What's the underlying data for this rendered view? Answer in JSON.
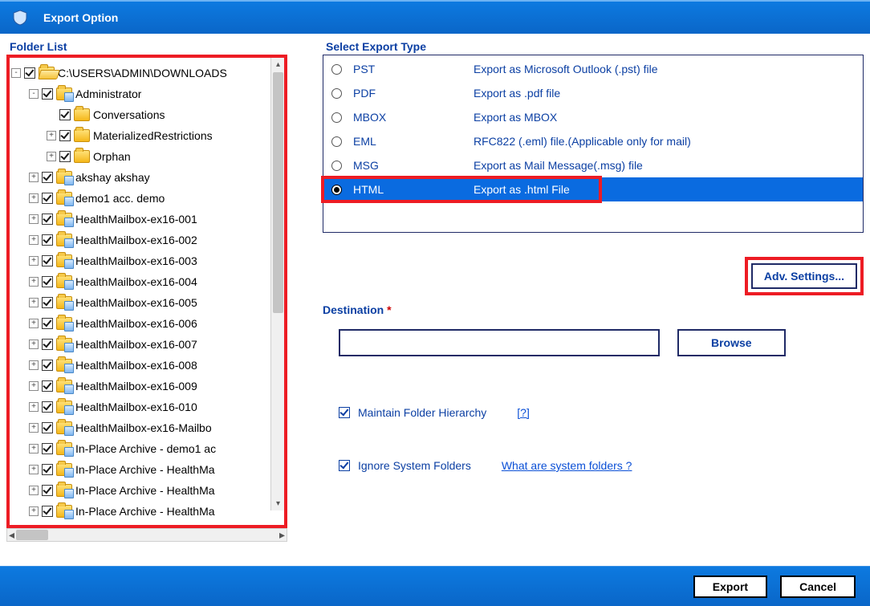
{
  "window": {
    "title": "Export Option"
  },
  "left": {
    "label": "Folder List",
    "tree": [
      {
        "depth": 0,
        "expander": "-",
        "icon": "open",
        "label": "C:\\USERS\\ADMIN\\DOWNLOADS"
      },
      {
        "depth": 1,
        "expander": "-",
        "icon": "db",
        "label": "Administrator"
      },
      {
        "depth": 2,
        "expander": "",
        "icon": "closed",
        "label": "Conversations"
      },
      {
        "depth": 2,
        "expander": "+",
        "icon": "closed",
        "label": "MaterializedRestrictions"
      },
      {
        "depth": 2,
        "expander": "+",
        "icon": "closed",
        "label": "Orphan"
      },
      {
        "depth": 1,
        "expander": "+",
        "icon": "db",
        "label": "akshay akshay"
      },
      {
        "depth": 1,
        "expander": "+",
        "icon": "db",
        "label": "demo1 acc. demo"
      },
      {
        "depth": 1,
        "expander": "+",
        "icon": "db",
        "label": "HealthMailbox-ex16-001"
      },
      {
        "depth": 1,
        "expander": "+",
        "icon": "db",
        "label": "HealthMailbox-ex16-002"
      },
      {
        "depth": 1,
        "expander": "+",
        "icon": "db",
        "label": "HealthMailbox-ex16-003"
      },
      {
        "depth": 1,
        "expander": "+",
        "icon": "db",
        "label": "HealthMailbox-ex16-004"
      },
      {
        "depth": 1,
        "expander": "+",
        "icon": "db",
        "label": "HealthMailbox-ex16-005"
      },
      {
        "depth": 1,
        "expander": "+",
        "icon": "db",
        "label": "HealthMailbox-ex16-006"
      },
      {
        "depth": 1,
        "expander": "+",
        "icon": "db",
        "label": "HealthMailbox-ex16-007"
      },
      {
        "depth": 1,
        "expander": "+",
        "icon": "db",
        "label": "HealthMailbox-ex16-008"
      },
      {
        "depth": 1,
        "expander": "+",
        "icon": "db",
        "label": "HealthMailbox-ex16-009"
      },
      {
        "depth": 1,
        "expander": "+",
        "icon": "db",
        "label": "HealthMailbox-ex16-010"
      },
      {
        "depth": 1,
        "expander": "+",
        "icon": "db",
        "label": "HealthMailbox-ex16-Mailbo"
      },
      {
        "depth": 1,
        "expander": "+",
        "icon": "db",
        "label": "In-Place Archive - demo1 ac"
      },
      {
        "depth": 1,
        "expander": "+",
        "icon": "db",
        "label": "In-Place Archive - HealthMa"
      },
      {
        "depth": 1,
        "expander": "+",
        "icon": "db",
        "label": "In-Place Archive - HealthMa"
      },
      {
        "depth": 1,
        "expander": "+",
        "icon": "db",
        "label": "In-Place Archive - HealthMa"
      }
    ]
  },
  "right": {
    "label": "Select Export Type",
    "formats": [
      {
        "fmt": "PST",
        "desc": "Export as Microsoft Outlook (.pst) file",
        "selected": false
      },
      {
        "fmt": "PDF",
        "desc": "Export as .pdf file",
        "selected": false
      },
      {
        "fmt": "MBOX",
        "desc": "Export as MBOX",
        "selected": false
      },
      {
        "fmt": "EML",
        "desc": "RFC822 (.eml) file.(Applicable only for mail)",
        "selected": false
      },
      {
        "fmt": "MSG",
        "desc": "Export as Mail Message(.msg) file",
        "selected": false
      },
      {
        "fmt": "HTML",
        "desc": "Export as .html File",
        "selected": true
      }
    ],
    "adv_button": "Adv. Settings...",
    "destination_label": "Destination",
    "destination_value": "",
    "browse": "Browse",
    "maintain_hierarchy": {
      "label": "Maintain Folder Hierarchy",
      "link": "[?]",
      "checked": true
    },
    "ignore_system": {
      "label": "Ignore System Folders",
      "link": "What are system folders ?",
      "checked": true
    }
  },
  "footer": {
    "export": "Export",
    "cancel": "Cancel"
  }
}
